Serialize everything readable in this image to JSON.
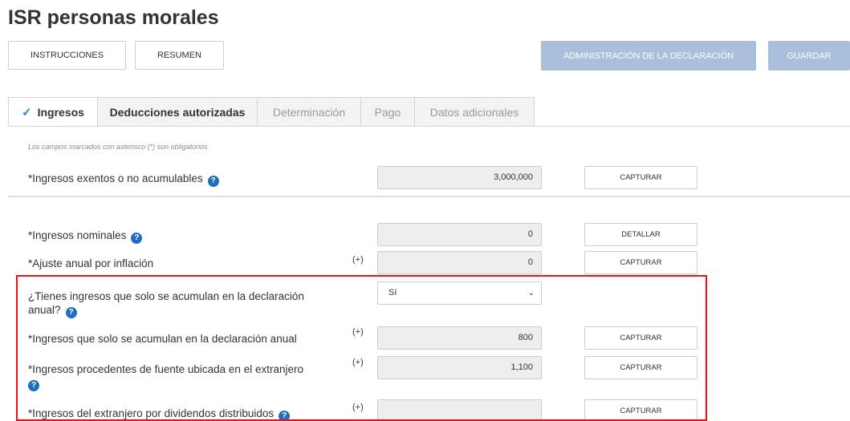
{
  "page": {
    "title": "ISR personas morales"
  },
  "toolbar": {
    "instrucciones": "INSTRUCCIONES",
    "resumen": "RESUMEN",
    "administracion": "ADMINISTRACIÓN DE LA DECLARACIÓN",
    "guardar": "GUARDAR"
  },
  "tabs": [
    {
      "label": "Ingresos",
      "state": "active"
    },
    {
      "label": "Deducciones autorizadas",
      "state": "enabled"
    },
    {
      "label": "Determinación",
      "state": "disabled"
    },
    {
      "label": "Pago",
      "state": "disabled"
    },
    {
      "label": "Datos adicionales",
      "state": "disabled"
    }
  ],
  "form": {
    "note": "Los campos marcados con asterisco (*) son obligatorios",
    "plus_sign": "(+)",
    "rows": [
      {
        "label": "*Ingresos exentos o no acumulables",
        "value": "3,000,000",
        "action": "CAPTURAR"
      },
      {
        "label": "*Ingresos nominales",
        "value": "0",
        "action": "DETALLAR"
      },
      {
        "label": "*Ajuste anual por inflación",
        "value": "0",
        "action": "CAPTURAR"
      },
      {
        "label_line1": "¿Tienes ingresos que solo se acumulan en la declaración",
        "label_line2": "anual?",
        "selected": "Sí"
      },
      {
        "label": "*Ingresos que solo se acumulan en la declaración anual",
        "value": "800",
        "action": "CAPTURAR"
      },
      {
        "label": "*Ingresos procedentes de fuente ubicada en el extranjero",
        "value": "1,100",
        "action": "CAPTURAR"
      },
      {
        "label": "*Ingresos del extranjero por dividendos distribuidos",
        "value": "",
        "action": "CAPTURAR"
      }
    ]
  },
  "colors": {
    "accent": "#1f6fc1",
    "highlight_border": "#e8121b",
    "disabled_button": "#a9bfdc"
  }
}
